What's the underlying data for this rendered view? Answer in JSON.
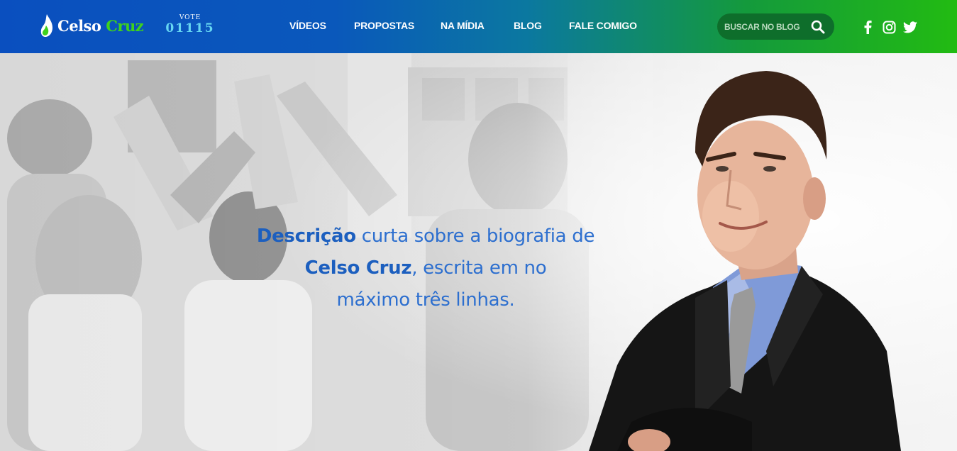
{
  "header": {
    "logo": {
      "first": "Celso",
      "second": "Cruz"
    },
    "vote": {
      "label": "VOTE",
      "number": "01115"
    },
    "nav": [
      {
        "label": "VÍDEOS"
      },
      {
        "label": "PROPOSTAS"
      },
      {
        "label": "NA MÍDIA"
      },
      {
        "label": "BLOG"
      },
      {
        "label": "FALE COMIGO"
      }
    ],
    "search": {
      "placeholder": "BUSCAR NO BLOG",
      "icon": "search-icon"
    },
    "social": [
      {
        "icon": "facebook-icon"
      },
      {
        "icon": "instagram-icon"
      },
      {
        "icon": "twitter-icon"
      }
    ]
  },
  "hero": {
    "line1_strong": "Descrição",
    "line1_rest": " curta sobre a biografia de",
    "line2_strong": "Celso Cruz",
    "line2_rest": ", escrita em no",
    "line3": "máximo três linhas."
  },
  "colors": {
    "nav_gradient_start": "#0a4fbf",
    "nav_gradient_end": "#22bb12",
    "logo_accent": "#3fd21b",
    "vote_number": "#66d6f2",
    "hero_text": "#2d6fcf",
    "search_bg": "#0e6e2b"
  }
}
